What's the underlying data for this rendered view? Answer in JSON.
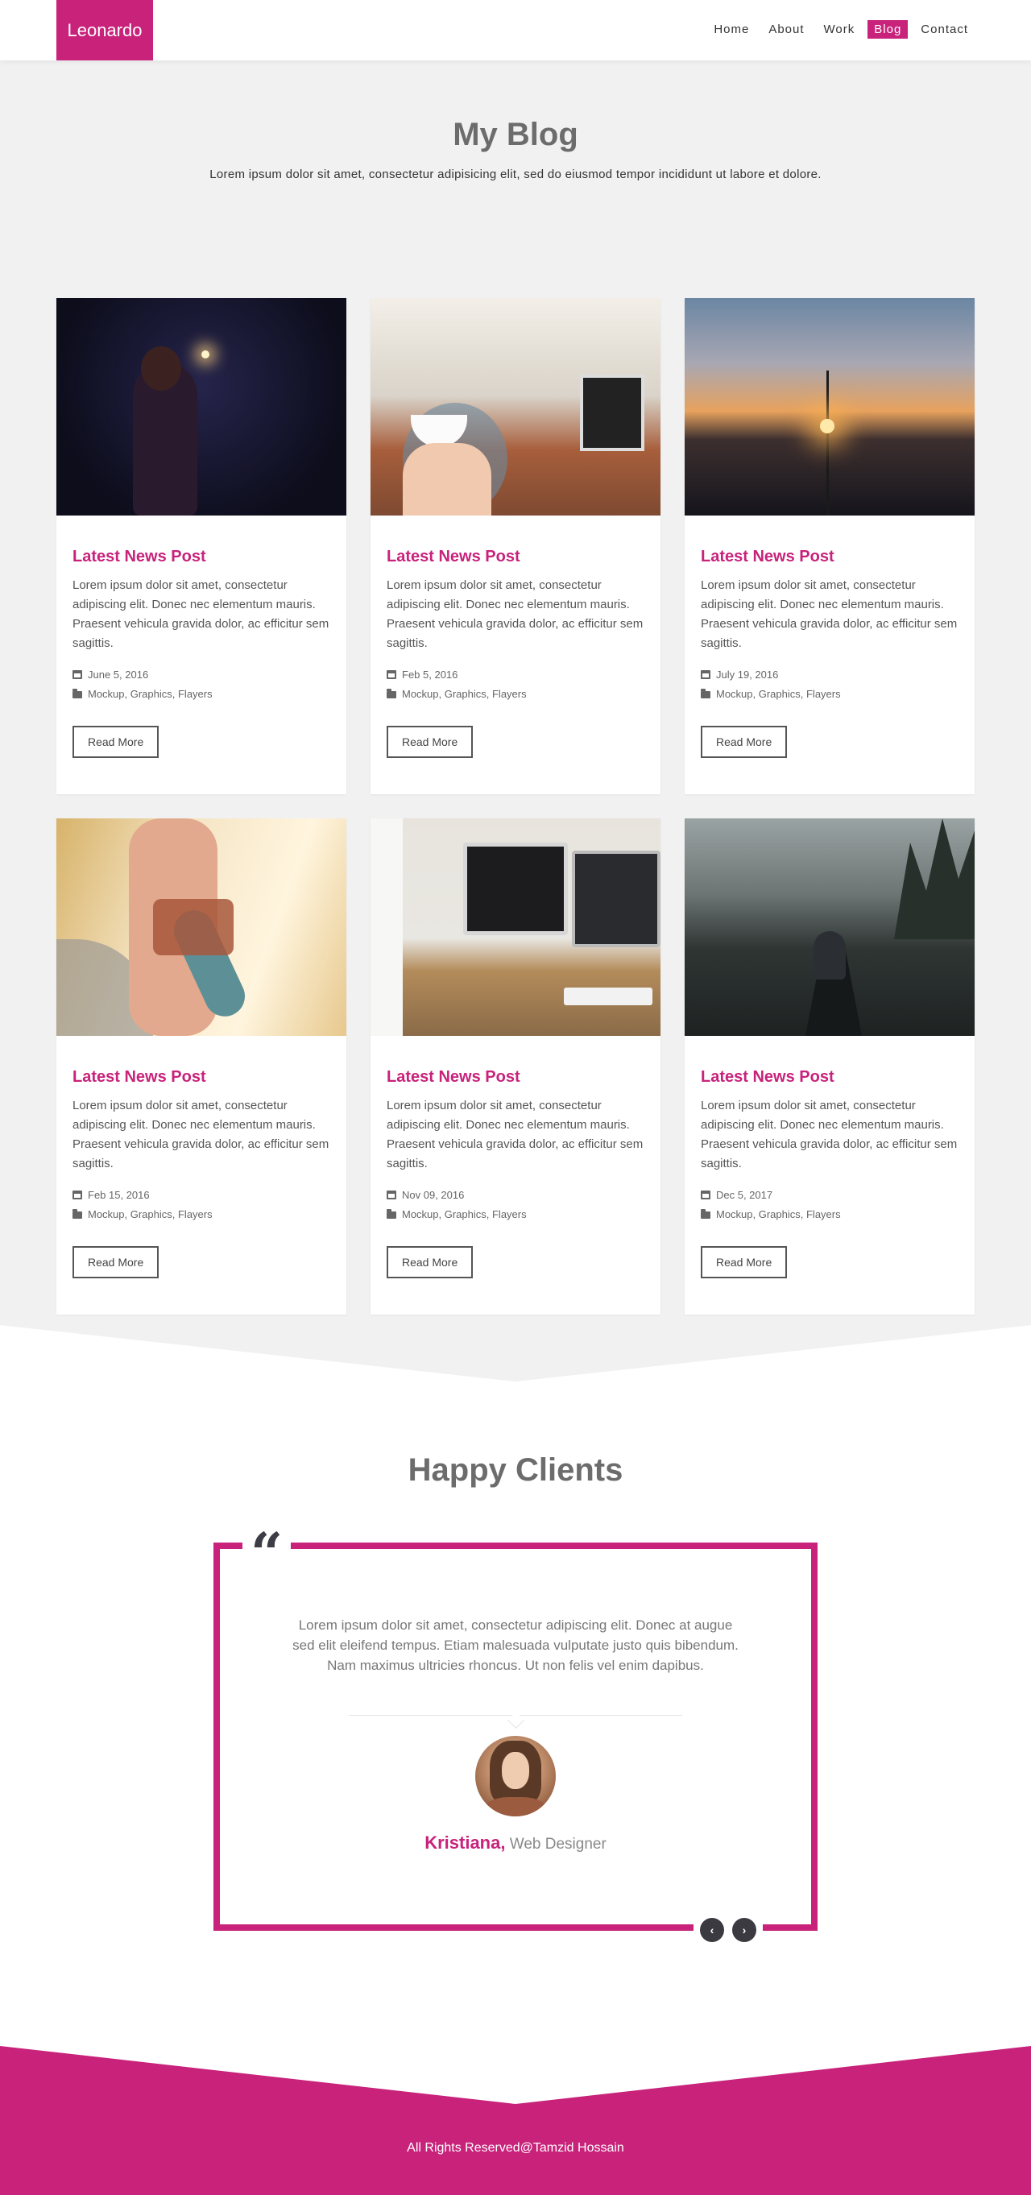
{
  "header": {
    "logo": "Leonardo",
    "nav": [
      {
        "label": "Home"
      },
      {
        "label": "About"
      },
      {
        "label": "Work"
      },
      {
        "label": "Blog",
        "active": true
      },
      {
        "label": "Contact"
      }
    ]
  },
  "blog": {
    "title": "My Blog",
    "subtitle": "Lorem ipsum dolor sit amet, consectetur adipisicing elit, sed do eiusmod tempor incididunt ut labore et dolore.",
    "posts": [
      {
        "title": "Latest News Post",
        "text": "Lorem ipsum dolor sit amet, consectetur adipiscing elit. Donec nec elementum mauris. Praesent vehicula gravida dolor, ac efficitur sem sagittis.",
        "date": "June 5, 2016",
        "tags": "Mockup, Graphics, Flayers",
        "button": "Read More"
      },
      {
        "title": "Latest News Post",
        "text": "Lorem ipsum dolor sit amet, consectetur adipiscing elit. Donec nec elementum mauris. Praesent vehicula gravida dolor, ac efficitur sem sagittis.",
        "date": "Feb 5, 2016",
        "tags": "Mockup, Graphics, Flayers",
        "button": "Read More"
      },
      {
        "title": "Latest News Post",
        "text": "Lorem ipsum dolor sit amet, consectetur adipiscing elit. Donec nec elementum mauris. Praesent vehicula gravida dolor, ac efficitur sem sagittis.",
        "date": "July 19, 2016",
        "tags": "Mockup, Graphics, Flayers",
        "button": "Read More"
      },
      {
        "title": "Latest News Post",
        "text": "Lorem ipsum dolor sit amet, consectetur adipiscing elit. Donec nec elementum mauris. Praesent vehicula gravida dolor, ac efficitur sem sagittis.",
        "date": "Feb 15, 2016",
        "tags": "Mockup, Graphics, Flayers",
        "button": "Read More"
      },
      {
        "title": "Latest News Post",
        "text": "Lorem ipsum dolor sit amet, consectetur adipiscing elit. Donec nec elementum mauris. Praesent vehicula gravida dolor, ac efficitur sem sagittis.",
        "date": "Nov 09, 2016",
        "tags": "Mockup, Graphics, Flayers",
        "button": "Read More"
      },
      {
        "title": "Latest News Post",
        "text": "Lorem ipsum dolor sit amet, consectetur adipiscing elit. Donec nec elementum mauris. Praesent vehicula gravida dolor, ac efficitur sem sagittis.",
        "date": "Dec 5, 2017",
        "tags": "Mockup, Graphics, Flayers",
        "button": "Read More"
      }
    ]
  },
  "clients": {
    "title": "Happy Clients",
    "quote_mark": "“",
    "quote": "Lorem ipsum dolor sit amet, consectetur adipiscing elit. Donec at augue sed elit eleifend tempus. Etiam malesuada vulputate justo quis bibendum. Nam maximus ultricies rhoncus. Ut non felis vel enim dapibus.",
    "name": "Kristiana,",
    "role": " Web Designer",
    "prev_icon": "‹",
    "next_icon": "›"
  },
  "footer": {
    "text": "All Rights Reserved@Tamzid Hossain"
  },
  "colors": {
    "accent": "#c8227b",
    "section_bg": "#f1f1f1",
    "title_gray": "#6c6c6c"
  }
}
